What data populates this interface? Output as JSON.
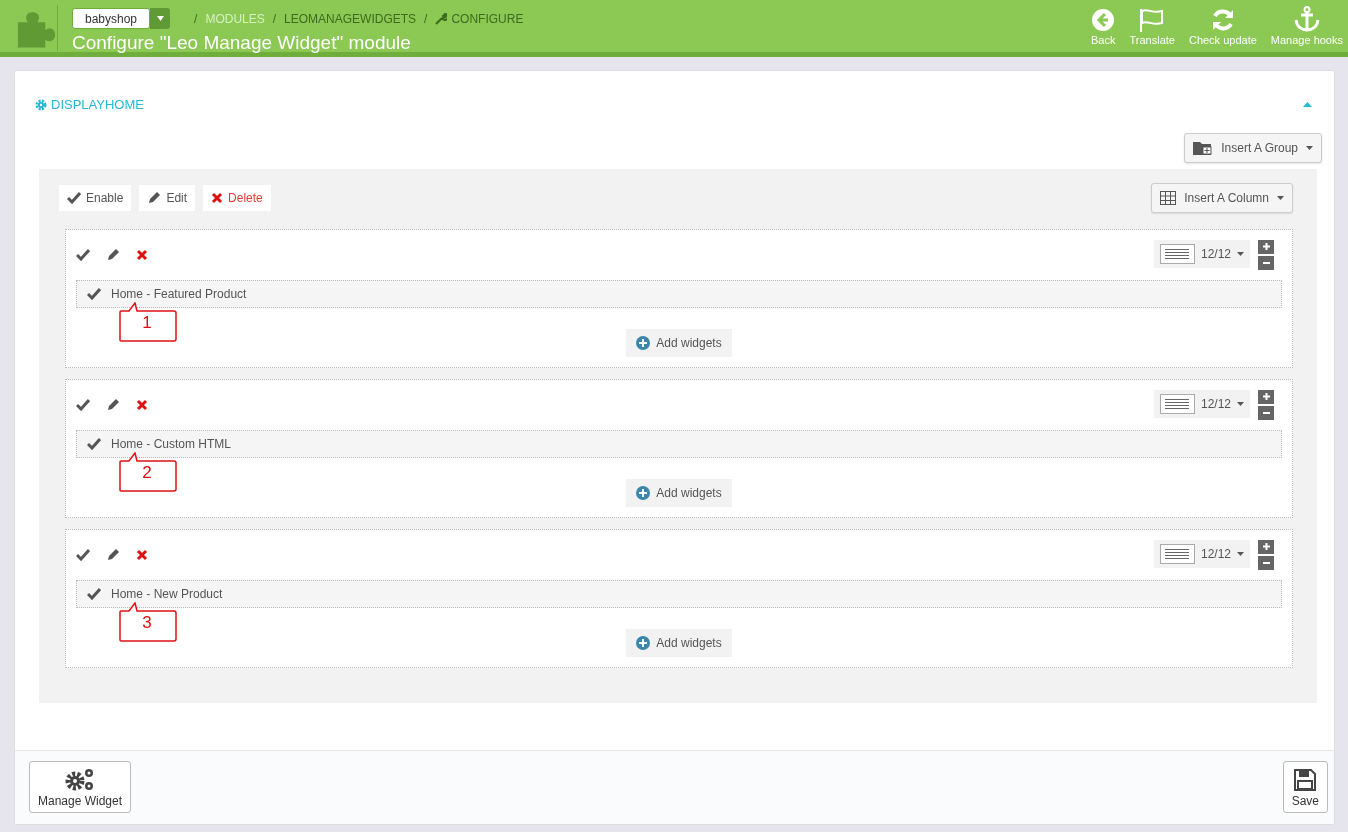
{
  "header": {
    "shop": "babyshop",
    "breadcrumb": [
      {
        "separator": "/",
        "label": "MODULES",
        "kind": "muted"
      },
      {
        "separator": "/",
        "label": "LEOMANAGEWIDGETS",
        "kind": "strong"
      },
      {
        "separator": "/",
        "label": "CONFIGURE",
        "kind": "icon"
      }
    ],
    "title": "Configure \"Leo Manage Widget\" module",
    "actions": [
      {
        "label": "Back",
        "kind": "back"
      },
      {
        "label": "Translate",
        "kind": "flag"
      },
      {
        "label": "Check update",
        "kind": "refresh"
      },
      {
        "label": "Manage hooks",
        "kind": "anchor"
      }
    ]
  },
  "panel": {
    "heading": "DISPLAYHOME",
    "insert_group": "Insert A Group",
    "group_toolbar": [
      {
        "label": "Enable",
        "kind": "enable"
      },
      {
        "label": "Edit",
        "kind": "edit"
      },
      {
        "label": "Delete",
        "kind": "delete"
      }
    ],
    "insert_column": "Insert A Column",
    "columns": [
      {
        "width": "12/12",
        "widgets": [
          {
            "label": "Home - Featured Product",
            "callout": "1"
          }
        ],
        "add_label": "Add widgets"
      },
      {
        "width": "12/12",
        "widgets": [
          {
            "label": "Home - Custom HTML",
            "callout": "2"
          }
        ],
        "add_label": "Add widgets"
      },
      {
        "width": "12/12",
        "widgets": [
          {
            "label": "Home - New Product",
            "callout": "3"
          }
        ],
        "add_label": "Add widgets"
      }
    ]
  },
  "footer": {
    "buttons": [
      {
        "label": "Manage Widget",
        "kind": "manage"
      },
      {
        "label": "Save",
        "kind": "save"
      }
    ]
  }
}
